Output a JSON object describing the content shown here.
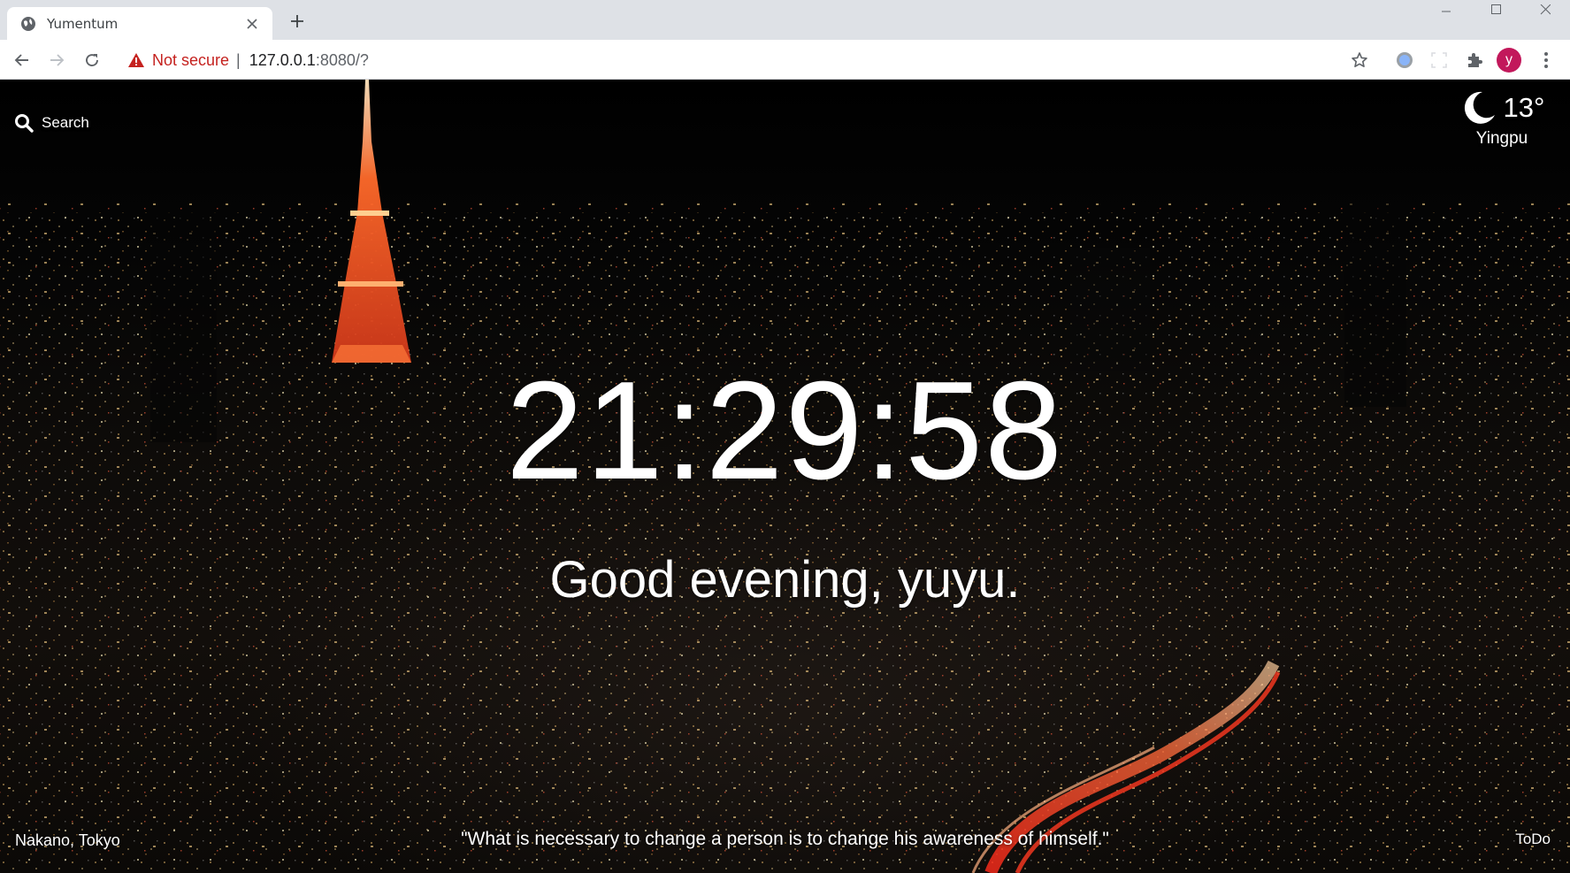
{
  "browser": {
    "tab_title": "Yumentum",
    "security_label": "Not secure",
    "url_host": "127.0.0.1",
    "url_rest": ":8080/?",
    "profile_initial": "y",
    "colors": {
      "tabstrip": "#dee1e6",
      "warning": "#c5221f",
      "avatar": "#c2185b"
    }
  },
  "page": {
    "search_label": "Search",
    "weather": {
      "icon": "moon-icon",
      "temperature": "13°",
      "location": "Yingpu"
    },
    "clock": "21:29:58",
    "greeting": "Good evening, yuyu.",
    "photo_location": "Nakano, Tokyo",
    "quote": "\"What is necessary to change a person is to change his awareness of himself.\"",
    "todo_label": "ToDo"
  }
}
